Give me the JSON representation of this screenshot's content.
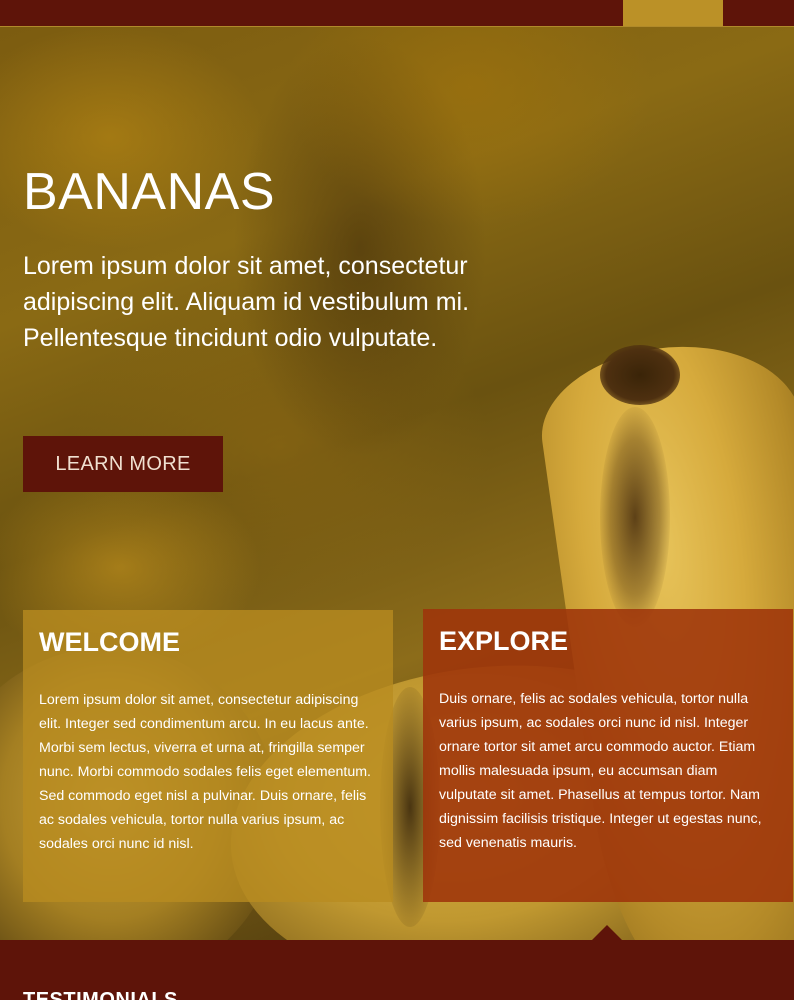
{
  "top_bar": {
    "accent_color": "#bb9127",
    "background_color": "#5e1409"
  },
  "hero": {
    "title": "BANANAS",
    "text": "Lorem ipsum dolor sit amet, consectetur adipiscing elit. Aliquam id vestibulum mi. Pellentesque tincidunt odio vulputate.",
    "cta_label": "LEARN MORE"
  },
  "panels": {
    "welcome": {
      "title": "WELCOME",
      "text": "Lorem ipsum dolor sit amet, consectetur adipiscing elit. Integer sed condimentum arcu. In eu lacus ante. Morbi sem lectus, viverra et urna at, fringilla semper nunc. Morbi commodo sodales felis eget elementum. Sed commodo eget nisl a pulvinar. Duis ornare, felis ac sodales vehicula, tortor nulla varius ipsum, ac sodales orci nunc id nisl.",
      "color": "#b98c20"
    },
    "explore": {
      "title": "EXPLORE",
      "text": "Duis ornare, felis ac sodales vehicula, tortor nulla varius ipsum, ac sodales orci nunc id nisl. Integer ornare tortor sit amet arcu commodo auctor. Etiam mollis malesuada ipsum, eu accumsan diam vulputate sit amet. Phasellus at tempus tortor. Nam dignissim facilisis tristique. Integer ut egestas nunc, sed venenatis mauris.",
      "color": "#9e340a"
    }
  },
  "testimonials": {
    "heading": "TESTIMONIALS"
  }
}
